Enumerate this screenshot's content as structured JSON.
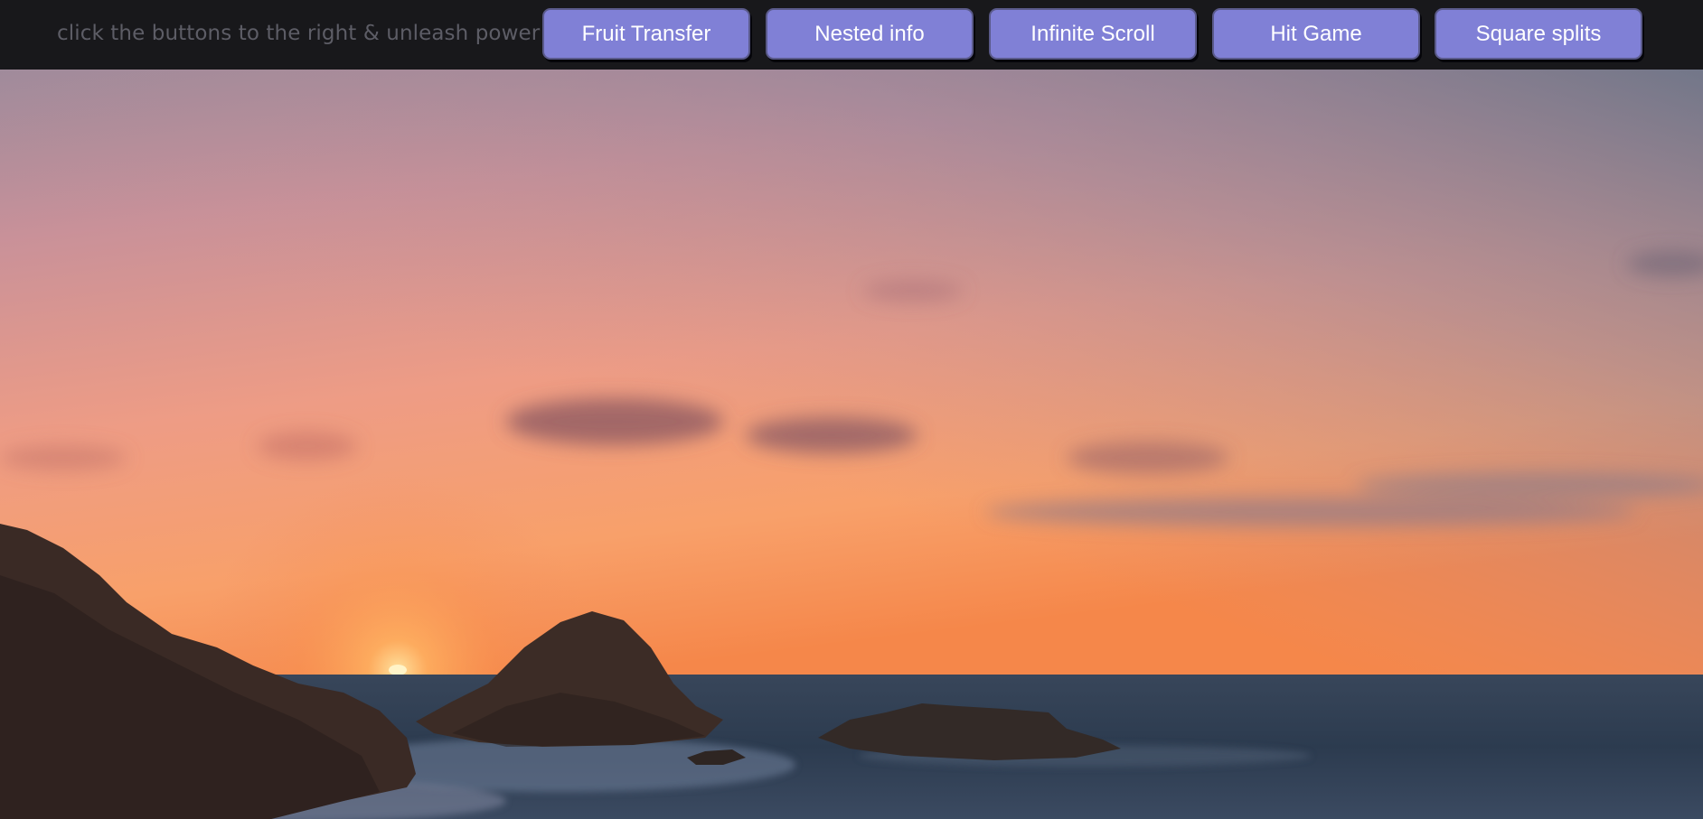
{
  "header": {
    "tagline": "click the buttons to the right & unleash power!",
    "buttons": [
      {
        "label": "Fruit Transfer"
      },
      {
        "label": "Nested info"
      },
      {
        "label": "Infinite Scroll"
      },
      {
        "label": "Hit Game"
      },
      {
        "label": "Square splits"
      }
    ]
  },
  "colors": {
    "header_bg": "#18181b",
    "tagline": "#5d5d66",
    "button_bg": "#8080d6",
    "button_text": "#ffffff"
  },
  "hero": {
    "image": "sunset-over-sea-with-rocks-photo"
  }
}
